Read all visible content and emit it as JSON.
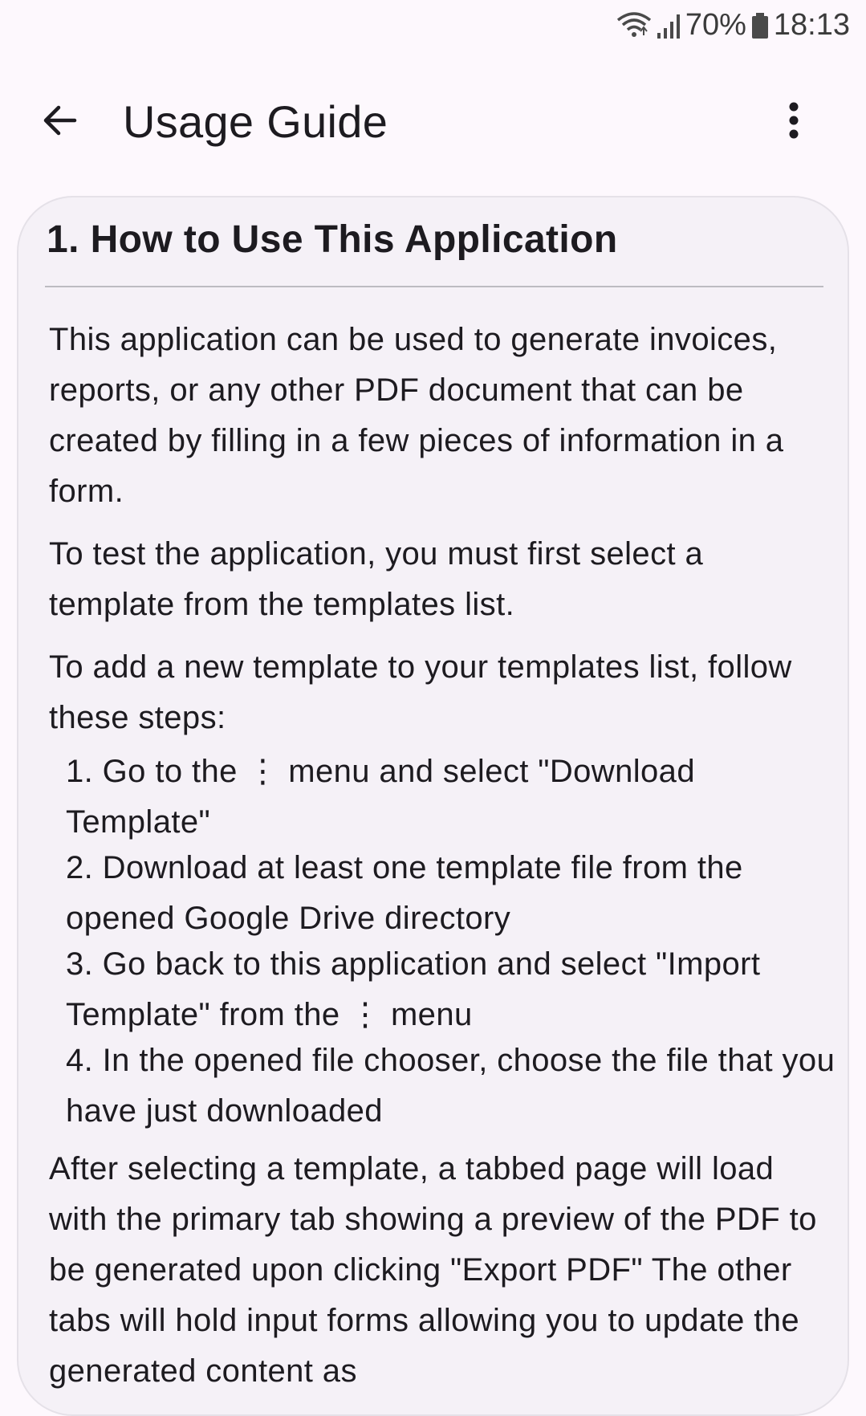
{
  "status_bar": {
    "battery": "70%",
    "time": "18:13"
  },
  "app_bar": {
    "title": "Usage Guide"
  },
  "section": {
    "title": "1. How to Use This Application",
    "paragraphs": [
      "This application can be used to generate invoices, reports, or any other PDF document that can be created by filling in a few pieces of information in a form.",
      "To test the application, you must first select a template from the templates list.",
      "To add a new template to your templates list, follow these steps:"
    ],
    "steps": [
      "1. Go to the ⋮ menu and select \"Download Template\"",
      "2. Download at least one template file from the opened Google Drive directory",
      "3. Go back to this application and select \"Import Template\" from the ⋮ menu",
      "4. In the opened file chooser, choose the file that you have just downloaded"
    ],
    "after_steps": "After selecting a template, a tabbed page will load with the primary tab showing a preview of the PDF to be generated upon clicking \"Export PDF\" The other tabs will hold input forms allowing you to update the generated content as"
  },
  "icons": {
    "back": "arrow-back-icon",
    "more": "more-vert-icon",
    "wifi": "wifi-icon",
    "signal": "signal-icon",
    "battery": "battery-icon"
  }
}
